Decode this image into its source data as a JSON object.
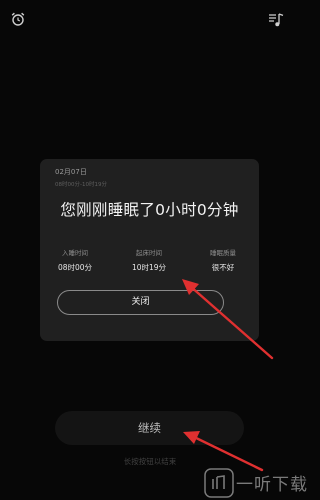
{
  "header": {
    "left_icon": "alarm-clock-icon",
    "right_icon": "music-note-list-icon"
  },
  "dialog": {
    "date": "02月07日",
    "time_range": "08时00分-10时19分",
    "title": "您刚刚睡眠了0小时0分钟",
    "stats": [
      {
        "label": "入睡时间",
        "value": "08时00分"
      },
      {
        "label": "起床时间",
        "value": "10时19分"
      },
      {
        "label": "睡眠质量",
        "value": "很不好"
      }
    ],
    "close_label": "关闭"
  },
  "main": {
    "continue_label": "继续",
    "hint": "长按按钮以结束"
  },
  "annotations": {
    "arrow_color": "#e03030"
  },
  "watermark": {
    "text": "一听下载"
  }
}
